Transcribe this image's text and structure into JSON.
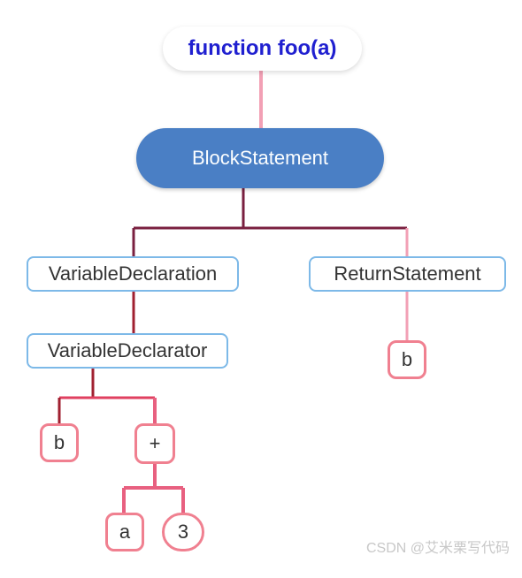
{
  "nodes": {
    "root": "function foo(a)",
    "block": "BlockStatement",
    "vardecl": "VariableDeclaration",
    "retstmt": "ReturnStatement",
    "vardtor": "VariableDeclarator",
    "b1": "b",
    "plus": "+",
    "a": "a",
    "three": "3",
    "b2": "b"
  },
  "watermark": "CSDN @艾米栗写代码"
}
